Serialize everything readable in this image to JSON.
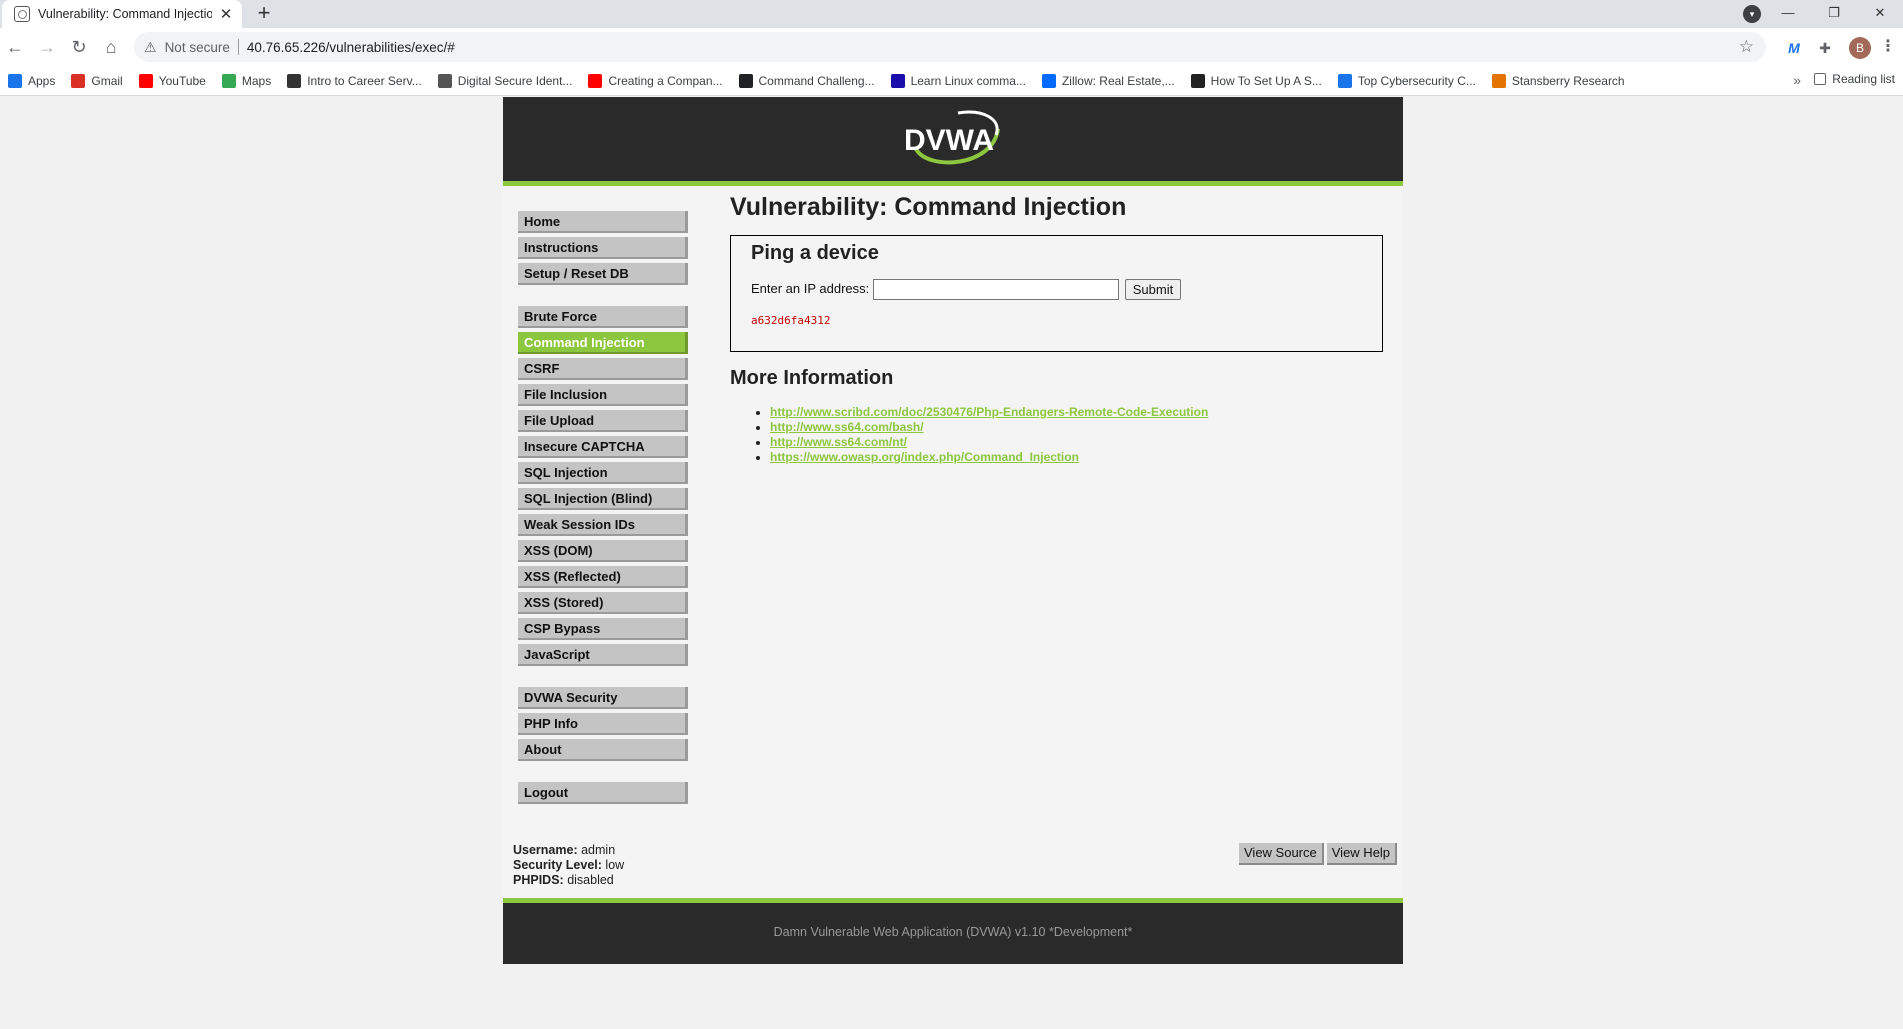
{
  "browser": {
    "tab_title": "Vulnerability: Command Injection",
    "tab_close": "✕",
    "new_tab": "+",
    "not_secure": "Not secure",
    "url": "40.76.65.226/vulnerabilities/exec/#",
    "avatar_initial": "B",
    "bookmarks": [
      {
        "label": "Apps",
        "icon": "apps-grid-icon",
        "color": "#1a73e8"
      },
      {
        "label": "Gmail",
        "icon": "gmail-icon",
        "color": "#d93025"
      },
      {
        "label": "YouTube",
        "icon": "youtube-icon",
        "color": "#ff0000"
      },
      {
        "label": "Maps",
        "icon": "maps-pin-icon",
        "color": "#34a853"
      },
      {
        "label": "Intro to Career Serv...",
        "icon": "cs-icon",
        "color": "#333333"
      },
      {
        "label": "Digital Secure Ident...",
        "icon": "dash-icon",
        "color": "#555555"
      },
      {
        "label": "Creating a Compan...",
        "icon": "youtube-icon",
        "color": "#ff0000"
      },
      {
        "label": "Command Challeng...",
        "icon": "terminal-icon",
        "color": "#202124"
      },
      {
        "label": "Learn Linux comma...",
        "icon": "play-icon",
        "color": "#1a0dab"
      },
      {
        "label": "Zillow: Real Estate,...",
        "icon": "zillow-icon",
        "color": "#006aff"
      },
      {
        "label": "How To Set Up A S...",
        "icon": "sb-icon",
        "color": "#222222"
      },
      {
        "label": "Top Cybersecurity C...",
        "icon": "c-icon",
        "color": "#1a73e8"
      },
      {
        "label": "Stansberry Research",
        "icon": "stansberry-icon",
        "color": "#e37400"
      }
    ],
    "more_bookmarks": "»",
    "reading_list": "Reading list"
  },
  "dvwa": {
    "logo_text": "DVWA",
    "menu_groups": [
      [
        {
          "label": "Home",
          "selected": false
        },
        {
          "label": "Instructions",
          "selected": false
        },
        {
          "label": "Setup / Reset DB",
          "selected": false
        }
      ],
      [
        {
          "label": "Brute Force",
          "selected": false
        },
        {
          "label": "Command Injection",
          "selected": true
        },
        {
          "label": "CSRF",
          "selected": false
        },
        {
          "label": "File Inclusion",
          "selected": false
        },
        {
          "label": "File Upload",
          "selected": false
        },
        {
          "label": "Insecure CAPTCHA",
          "selected": false
        },
        {
          "label": "SQL Injection",
          "selected": false
        },
        {
          "label": "SQL Injection (Blind)",
          "selected": false
        },
        {
          "label": "Weak Session IDs",
          "selected": false
        },
        {
          "label": "XSS (DOM)",
          "selected": false
        },
        {
          "label": "XSS (Reflected)",
          "selected": false
        },
        {
          "label": "XSS (Stored)",
          "selected": false
        },
        {
          "label": "CSP Bypass",
          "selected": false
        },
        {
          "label": "JavaScript",
          "selected": false
        }
      ],
      [
        {
          "label": "DVWA Security",
          "selected": false
        },
        {
          "label": "PHP Info",
          "selected": false
        },
        {
          "label": "About",
          "selected": false
        }
      ],
      [
        {
          "label": "Logout",
          "selected": false
        }
      ]
    ],
    "page_title": "Vulnerability: Command Injection",
    "form": {
      "heading": "Ping a device",
      "label": "Enter an IP address:",
      "input_value": "",
      "submit": "Submit",
      "output": "a632d6fa4312"
    },
    "more_info_heading": "More Information",
    "links": [
      "http://www.scribd.com/doc/2530476/Php-Endangers-Remote-Code-Execution",
      "http://www.ss64.com/bash/",
      "http://www.ss64.com/nt/",
      "https://www.owasp.org/index.php/Command_Injection"
    ],
    "user": {
      "username_label": "Username:",
      "username": "admin",
      "security_label": "Security Level:",
      "security": "low",
      "phpids_label": "PHPIDS:",
      "phpids": "disabled"
    },
    "buttons": {
      "view_source": "View Source",
      "view_help": "View Help"
    },
    "footer": "Damn Vulnerable Web Application (DVWA) v1.10 *Development*"
  },
  "colors": {
    "accent": "#8dc63f",
    "header_bg": "#2a2a2a",
    "output_text": "#c00000"
  }
}
